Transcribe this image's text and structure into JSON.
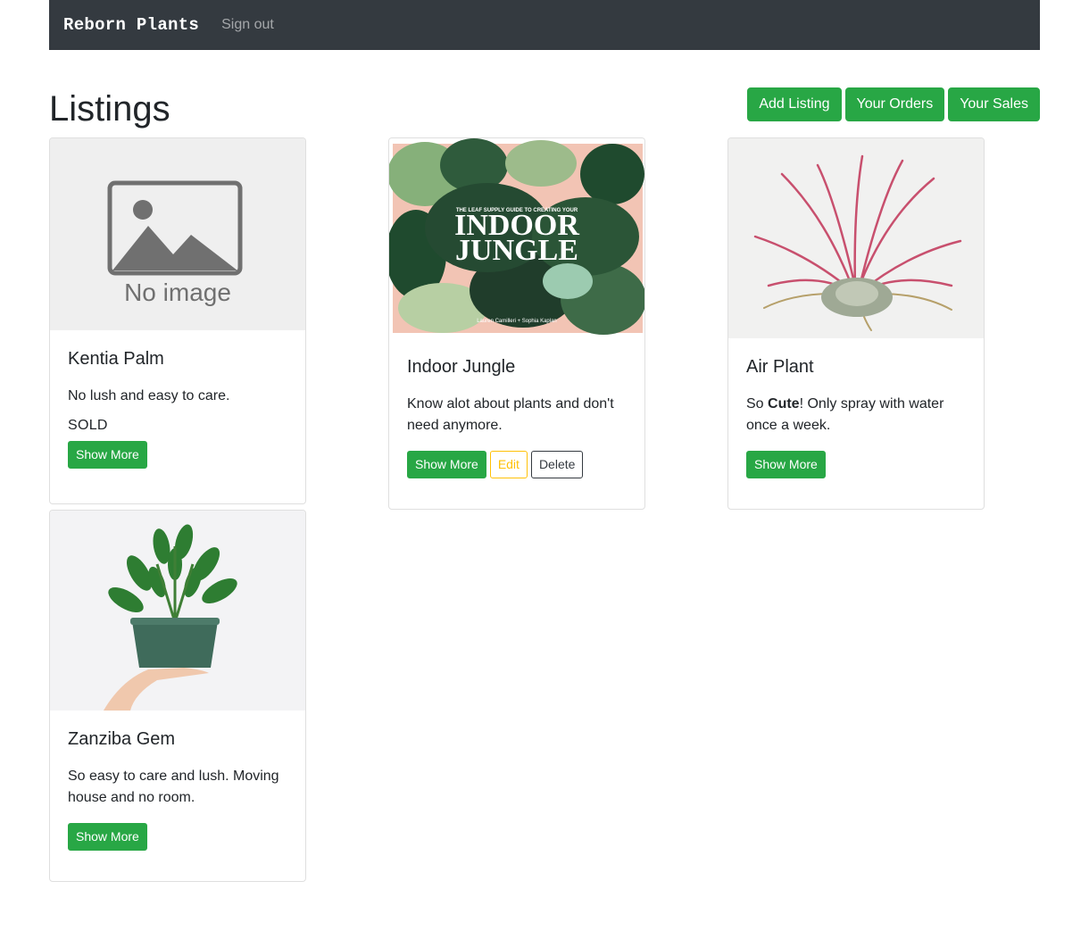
{
  "navbar": {
    "brand": "Reborn Plants",
    "sign_out": "Sign out"
  },
  "page": {
    "title": "Listings"
  },
  "actions": {
    "add_listing": "Add Listing",
    "your_orders": "Your Orders",
    "your_sales": "Your Sales"
  },
  "placeholder_image": {
    "caption": "No image"
  },
  "cover_image": {
    "headline_1": "INDOOR",
    "headline_2": "JUNGLE",
    "tagline": "THE LEAF SUPPLY GUIDE TO CREATING YOUR",
    "authors": "Lauren Camilleri + Sophia Kaplan"
  },
  "listings": [
    {
      "title": "Kentia Palm",
      "description": "No lush and easy to care.",
      "status": "SOLD",
      "show_more": "Show More"
    },
    {
      "title": "Indoor Jungle",
      "description": "Know alot about plants and don't need anymore.",
      "show_more": "Show More",
      "edit": "Edit",
      "delete": "Delete"
    },
    {
      "title": "Air Plant",
      "description_pre": "So ",
      "description_bold": "Cute",
      "description_post": "! Only spray with water once a week.",
      "show_more": "Show More"
    },
    {
      "title": "Zanziba Gem",
      "description": "So easy to care and lush. Moving house and no room.",
      "show_more": "Show More"
    }
  ],
  "colors": {
    "navbar": "#343a40",
    "success": "#28a745",
    "warning": "#ffc107",
    "dark": "#343a40"
  }
}
